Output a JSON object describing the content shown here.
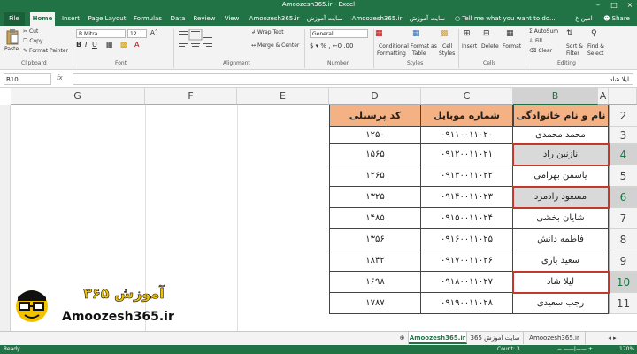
{
  "window": {
    "title": "Amoozesh365.ir - Excel"
  },
  "tabs": {
    "file": "File",
    "home": "Home",
    "insert": "Insert",
    "page_layout": "Page Layout",
    "formulas": "Formulas",
    "data": "Data",
    "review": "Review",
    "view": "View",
    "t1": "Amoozesh365.ir",
    "t2": "سایت آموزش 365",
    "t3": "Amoozesh365.ir",
    "t4": "سایت آموزش 365",
    "tellme": "Tell me what you want to do...",
    "user": "امین غ",
    "share": "Share"
  },
  "ribbon": {
    "paste": "Paste",
    "cut": "Cut",
    "copy": "Copy",
    "format_painter": "Format Painter",
    "font_name": "B Mitra",
    "font_size": "12",
    "wrap_text": "Wrap Text",
    "merge_center": "Merge & Center",
    "number_format": "General",
    "cond_format_1": "Conditional",
    "cond_format_2": "Formatting",
    "format_table_1": "Format as",
    "format_table_2": "Table",
    "cell_styles_1": "Cell",
    "cell_styles_2": "Styles",
    "insert": "Insert",
    "delete": "Delete",
    "format": "Format",
    "autosum": "AutoSum",
    "fill": "Fill",
    "clear": "Clear",
    "sort_1": "Sort &",
    "sort_2": "Filter",
    "find_1": "Find &",
    "find_2": "Select",
    "g_clipboard": "Clipboard",
    "g_font": "Font",
    "g_alignment": "Alignment",
    "g_number": "Number",
    "g_styles": "Styles",
    "g_cells": "Cells",
    "g_editing": "Editing"
  },
  "formula_bar": {
    "name_box": "B10",
    "fx": "fx",
    "value": "لیلا شاد"
  },
  "columns": [
    "A",
    "B",
    "C",
    "D",
    "E",
    "F",
    "G"
  ],
  "rows": [
    "2",
    "3",
    "4",
    "5",
    "6",
    "7",
    "8",
    "9",
    "10",
    "11"
  ],
  "table": {
    "headers": [
      "نام و نام خانوادگی",
      "شماره موبایل",
      "کد پرسنلی"
    ],
    "rows": [
      [
        "محمد محمدی",
        "۰۹۱۱۰۰۱۱۰۲۰",
        "۱۲۵۰"
      ],
      [
        "نازنین راد",
        "۰۹۱۲۰۰۱۱۰۲۱",
        "۱۵۶۵"
      ],
      [
        "یاسمن بهرامی",
        "۰۹۱۳۰۰۱۱۰۲۲",
        "۱۲۶۵"
      ],
      [
        "مسعود رادمرد",
        "۰۹۱۴۰۰۱۱۰۲۳",
        "۱۳۲۵"
      ],
      [
        "شایان بخشی",
        "۰۹۱۵۰۰۱۱۰۲۴",
        "۱۴۸۵"
      ],
      [
        "فاطمه دانش",
        "۰۹۱۶۰۰۱۱۰۲۵",
        "۱۳۵۶"
      ],
      [
        "سعید یاری",
        "۰۹۱۷۰۰۱۱۰۲۶",
        "۱۸۴۲"
      ],
      [
        "لیلا شاد",
        "۰۹۱۸۰۰۱۱۰۲۷",
        "۱۶۹۸"
      ],
      [
        "رجب سعیدی",
        "۰۹۱۹۰۰۱۱۰۲۸",
        "۱۷۸۷"
      ]
    ]
  },
  "sheets": [
    "Amoozesh365.ir",
    "سایت آموزش 365",
    "Amoozesh365.ir"
  ],
  "status": {
    "ready": "Ready",
    "count": "Count: 3",
    "zoom": "170%"
  },
  "logo": {
    "title": "آموزش ۳۶۵",
    "url": "Amoozesh365.ir"
  },
  "colors": {
    "excel_green": "#217346",
    "header_fill": "#f4b183",
    "highlight_border": "#c0392b"
  }
}
